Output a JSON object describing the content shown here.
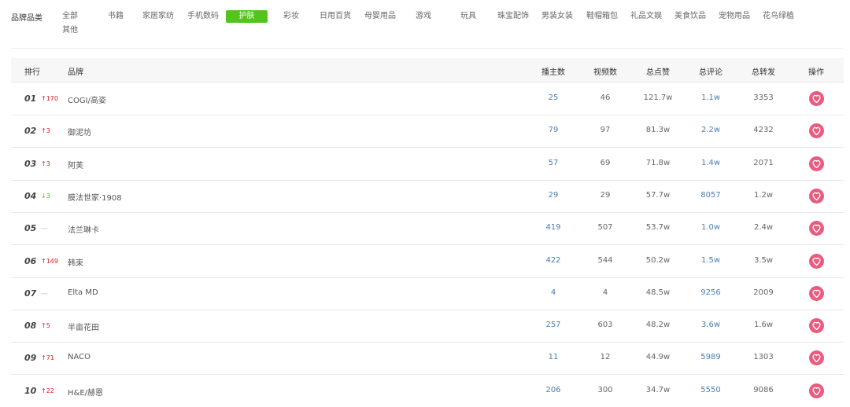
{
  "categories": {
    "label": "品牌品类",
    "items": [
      "全部",
      "书籍",
      "家居家纺",
      "手机数码",
      "护肤",
      "彩妆",
      "日用百货",
      "母婴用品",
      "游戏",
      "玩具",
      "珠宝配饰",
      "男装女装",
      "鞋帽箱包",
      "礼品文娱",
      "美食饮品",
      "宠物用品",
      "花鸟绿植",
      "其他"
    ],
    "active": "护肤"
  },
  "table": {
    "headers": {
      "rank": "排行",
      "brand": "品牌",
      "streamers": "播主数",
      "videos": "视频数",
      "likes": "总点赞",
      "comments": "总评论",
      "shares": "总转发",
      "action": "操作"
    },
    "rows": [
      {
        "rank": "01",
        "change": "↑170",
        "dir": "up",
        "brand": "COGI/高姿",
        "streamers": "25",
        "videos": "46",
        "likes": "121.7w",
        "comments": "1.1w",
        "shares": "3353"
      },
      {
        "rank": "02",
        "change": "↑3",
        "dir": "up",
        "brand": "御泥坊",
        "streamers": "79",
        "videos": "97",
        "likes": "81.3w",
        "comments": "2.2w",
        "shares": "4232"
      },
      {
        "rank": "03",
        "change": "↑3",
        "dir": "up",
        "brand": "阿芙",
        "streamers": "57",
        "videos": "69",
        "likes": "71.8w",
        "comments": "1.4w",
        "shares": "2071"
      },
      {
        "rank": "04",
        "change": "↓3",
        "dir": "down",
        "brand": "膜法世家·1908",
        "streamers": "29",
        "videos": "29",
        "likes": "57.7w",
        "comments": "8057",
        "shares": "1.2w"
      },
      {
        "rank": "05",
        "change": "---",
        "dir": "flat",
        "brand": "法兰琳卡",
        "streamers": "419",
        "videos": "507",
        "likes": "53.7w",
        "comments": "1.0w",
        "shares": "2.4w"
      },
      {
        "rank": "06",
        "change": "↑149",
        "dir": "up",
        "brand": "韩束",
        "streamers": "422",
        "videos": "544",
        "likes": "50.2w",
        "comments": "1.5w",
        "shares": "3.5w"
      },
      {
        "rank": "07",
        "change": "---",
        "dir": "flat",
        "brand": "Elta MD",
        "streamers": "4",
        "videos": "4",
        "likes": "48.5w",
        "comments": "9256",
        "shares": "2009"
      },
      {
        "rank": "08",
        "change": "↑5",
        "dir": "up",
        "brand": "半亩花田",
        "streamers": "257",
        "videos": "603",
        "likes": "48.2w",
        "comments": "3.6w",
        "shares": "1.6w"
      },
      {
        "rank": "09",
        "change": "↑71",
        "dir": "up",
        "brand": "NACO",
        "streamers": "11",
        "videos": "12",
        "likes": "44.9w",
        "comments": "5989",
        "shares": "1303"
      },
      {
        "rank": "10",
        "change": "↑22",
        "dir": "up",
        "brand": "H&E/赫恩",
        "streamers": "206",
        "videos": "300",
        "likes": "34.7w",
        "comments": "5550",
        "shares": "9086"
      }
    ]
  },
  "colors": {
    "accent": "#52c41a",
    "heart": "#ea5c7f",
    "up": "#e02020",
    "down": "#52c41a"
  },
  "icons": {
    "action": "heart-icon"
  }
}
